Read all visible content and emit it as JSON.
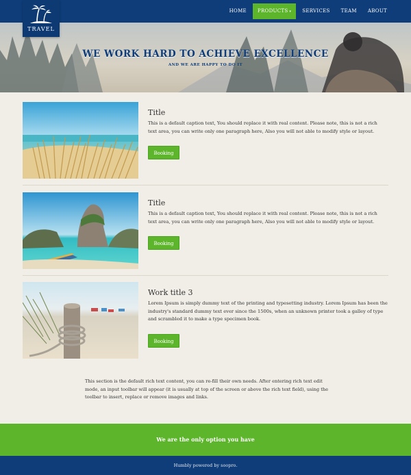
{
  "brand": {
    "logo_text": "TRAVEL",
    "logo_icon": "palm-tree-island-icon"
  },
  "nav": {
    "items": [
      {
        "label": "HOME"
      },
      {
        "label": "PRODUCTS",
        "caret": "▾"
      },
      {
        "label": "SERVICES"
      },
      {
        "label": "TEAM"
      },
      {
        "label": "ABOUT"
      }
    ]
  },
  "hero": {
    "title": "WE WORK HARD TO ACHIEVE EXCELLENCE",
    "subtitle": "AND WE ARE HAPPY TO DO IT"
  },
  "cards": [
    {
      "title": "Title",
      "text": "This is a default caption text, You should replace it with real content. Please note, this is not a rich text area, you can write only one paragraph here, Also you will not able to modify style or layout.",
      "button": "Booking"
    },
    {
      "title": "Title",
      "text": "This is a default caption text, You should replace it with real content. Please note, this is not a rich text area, you can write only one paragraph here, Also you will not able to modify style or layout.",
      "button": "Booking"
    },
    {
      "title": "Work title 3",
      "text": "Lorem Ipsum is simply dummy text of the printing and typesetting industry. Lorem Ipsum has been the industry's standard dummy text ever since the 1500s, when an unknown printer took a galley of type and scrambled it to make a type specimen book.",
      "button": "Booking"
    }
  ],
  "rich_text": "This section is the default rich text content, you can re-fill their own needs. After entering rich text edit mode, an input toolbar will appear (it is usually at top of the screen or above the rich text field), using the toolbar to insert, replace or remove images and links.",
  "band": {
    "text": "We are the only option you have"
  },
  "footer": {
    "text": "Humbly powered by soopro."
  },
  "colors": {
    "primary": "#0f3d7a",
    "accent": "#5cb52a",
    "background": "#f1eee7"
  }
}
